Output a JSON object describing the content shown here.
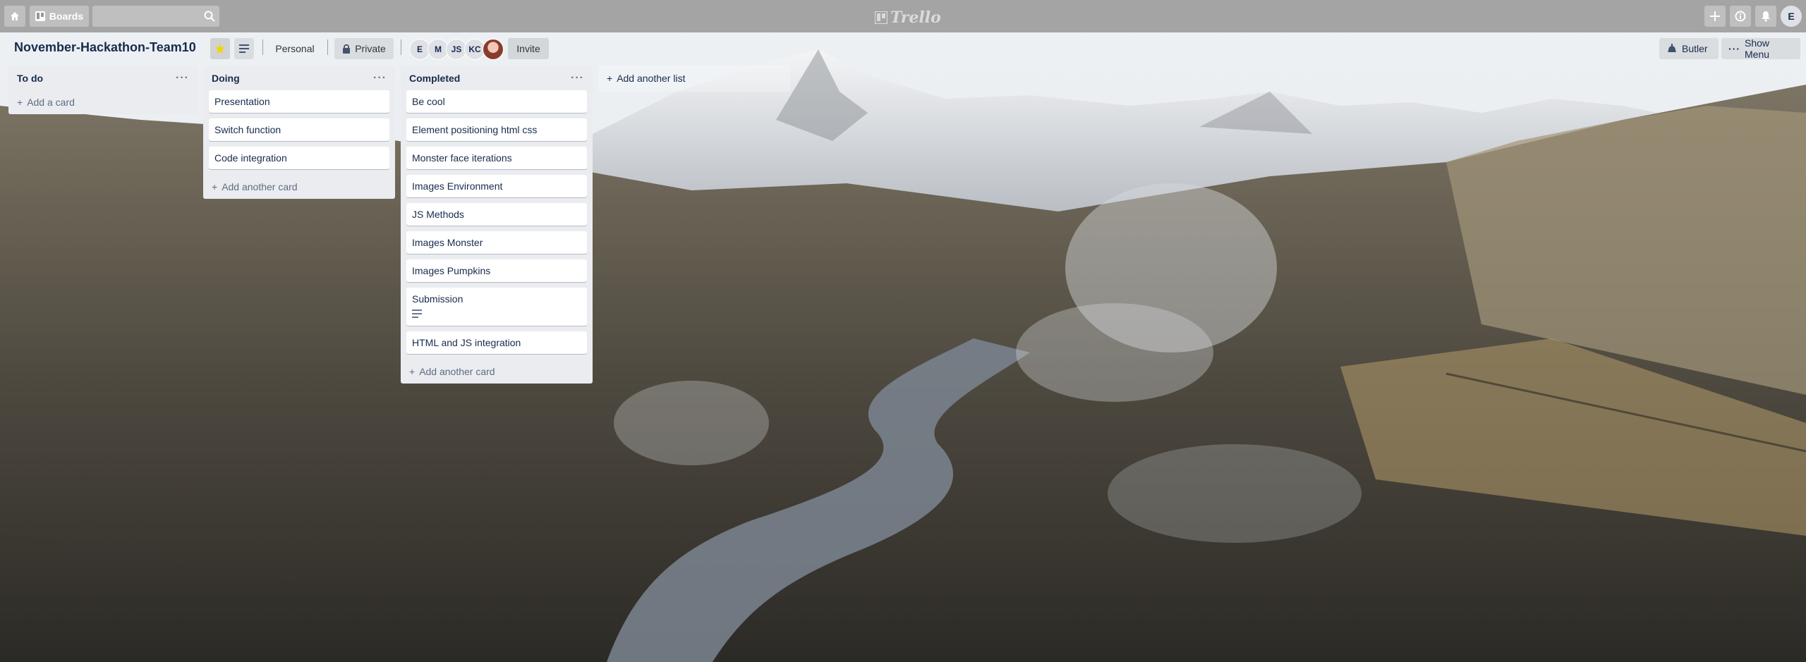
{
  "topbar": {
    "boards_label": "Boards",
    "search_placeholder": "",
    "logo_text": "Trello",
    "user_initial": "E"
  },
  "board": {
    "title": "November-Hackathon-Team10",
    "visibility_team": "Personal",
    "visibility_privacy": "Private",
    "invite_label": "Invite",
    "members": [
      "E",
      "M",
      "JS",
      "KC"
    ],
    "butler_label": "Butler",
    "show_menu_label": "Show Menu"
  },
  "lists": [
    {
      "name": "To do",
      "cards": [],
      "add_card_label": "Add a card"
    },
    {
      "name": "Doing",
      "cards": [
        "Presentation",
        "Switch function",
        "Code integration"
      ],
      "add_card_label": "Add another card"
    },
    {
      "name": "Completed",
      "cards": [
        "Be cool",
        "Element positioning html css",
        "Monster face iterations",
        "Images Environment",
        "JS Methods",
        "Images Monster",
        "Images Pumpkins",
        "Submission",
        "HTML and JS integration"
      ],
      "add_card_label": "Add another card"
    }
  ],
  "add_list_label": "Add another list",
  "colors": {
    "star_active": "#f2d600",
    "list_bg": "#ebecf0",
    "text": "#172b4d",
    "muted": "#5e6c84"
  }
}
